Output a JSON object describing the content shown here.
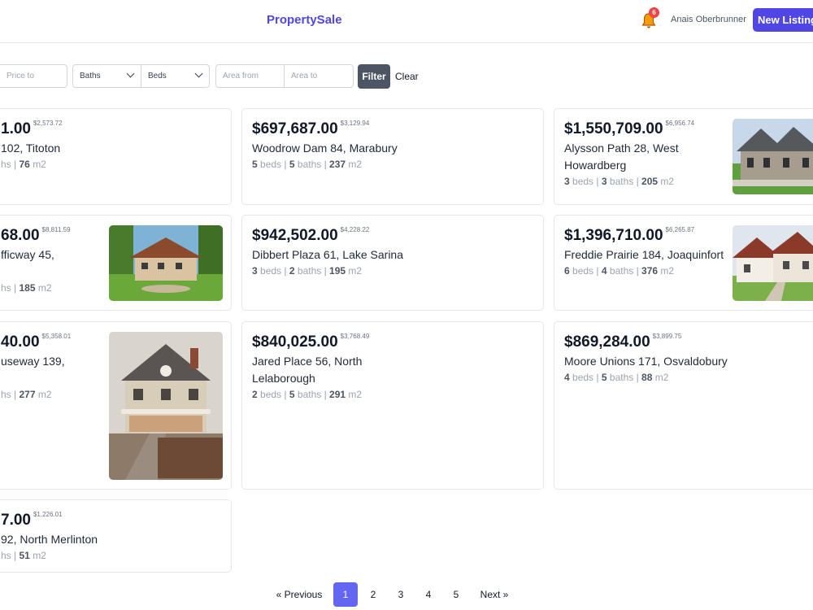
{
  "header": {
    "brand": "PropertySale",
    "notification_count": "6",
    "user_name": "Anais Oberbrunner",
    "new_listing_label": "New Listing"
  },
  "filters": {
    "price_to_placeholder": "Price to",
    "baths_label": "Baths",
    "beds_label": "Beds",
    "area_from_placeholder": "Area from",
    "area_to_placeholder": "Area to",
    "filter_label": "Filter",
    "clear_label": "Clear"
  },
  "listings": [
    {
      "price": "1.00",
      "price_per_m2": "$2,573.72",
      "address": "102, Titoton",
      "beds": "",
      "baths": "",
      "area": "76",
      "beds_label": "",
      "baths_label": "hs",
      "area_unit": "m2"
    },
    {
      "price": "$697,687.00",
      "price_per_m2": "$3,129.94",
      "address": "Woodrow Dam 84, Marabury",
      "beds": "5",
      "baths": "5",
      "area": "237",
      "beds_label": "beds",
      "baths_label": "baths",
      "area_unit": "m2"
    },
    {
      "price": "$1,550,709.00",
      "price_per_m2": "$6,956.74",
      "address": "Alysson Path 28, West Howardberg",
      "beds": "3",
      "baths": "3",
      "area": "205",
      "beds_label": "beds",
      "baths_label": "baths",
      "area_unit": "m2"
    },
    {
      "price": "68.00",
      "price_per_m2": "$8,811.59",
      "address": "fficway 45,",
      "beds": "",
      "baths": "",
      "area": "185",
      "beds_label": "",
      "baths_label": "hs",
      "area_unit": "m2"
    },
    {
      "price": "$942,502.00",
      "price_per_m2": "$4,228.22",
      "address": "Dibbert Plaza 61, Lake Sarina",
      "beds": "3",
      "baths": "2",
      "area": "195",
      "beds_label": "beds",
      "baths_label": "baths",
      "area_unit": "m2"
    },
    {
      "price": "$1,396,710.00",
      "price_per_m2": "$6,265.87",
      "address": "Freddie Prairie 184, Joaquinfort",
      "beds": "6",
      "baths": "4",
      "area": "376",
      "beds_label": "beds",
      "baths_label": "baths",
      "area_unit": "m2"
    },
    {
      "price": "40.00",
      "price_per_m2": "$5,358.01",
      "address": "useway 139,",
      "beds": "",
      "baths": "",
      "area": "277",
      "beds_label": "",
      "baths_label": "hs",
      "area_unit": "m2"
    },
    {
      "price": "$840,025.00",
      "price_per_m2": "$3,768.49",
      "address": "Jared Place 56, North Lelaborough",
      "beds": "2",
      "baths": "5",
      "area": "291",
      "beds_label": "beds",
      "baths_label": "baths",
      "area_unit": "m2"
    },
    {
      "price": "$869,284.00",
      "price_per_m2": "$3,899.75",
      "address": "Moore Unions 171, Osvaldobury",
      "beds": "4",
      "baths": "5",
      "area": "88",
      "beds_label": "beds",
      "baths_label": "baths",
      "area_unit": "m2"
    },
    {
      "price": "7.00",
      "price_per_m2": "$1,226.01",
      "address": "92, North Merlinton",
      "beds": "",
      "baths": "",
      "area": "51",
      "beds_label": "",
      "baths_label": "hs",
      "area_unit": "m2"
    }
  ],
  "pagination": {
    "previous_label": "« Previous",
    "pages": [
      "1",
      "2",
      "3",
      "4",
      "5"
    ],
    "current_page": "1",
    "next_label": "Next »"
  },
  "colors": {
    "accent": "#4f46e5",
    "active_page": "#6366f1",
    "filter_button": "#4b5563",
    "badge": "#ef4444"
  }
}
